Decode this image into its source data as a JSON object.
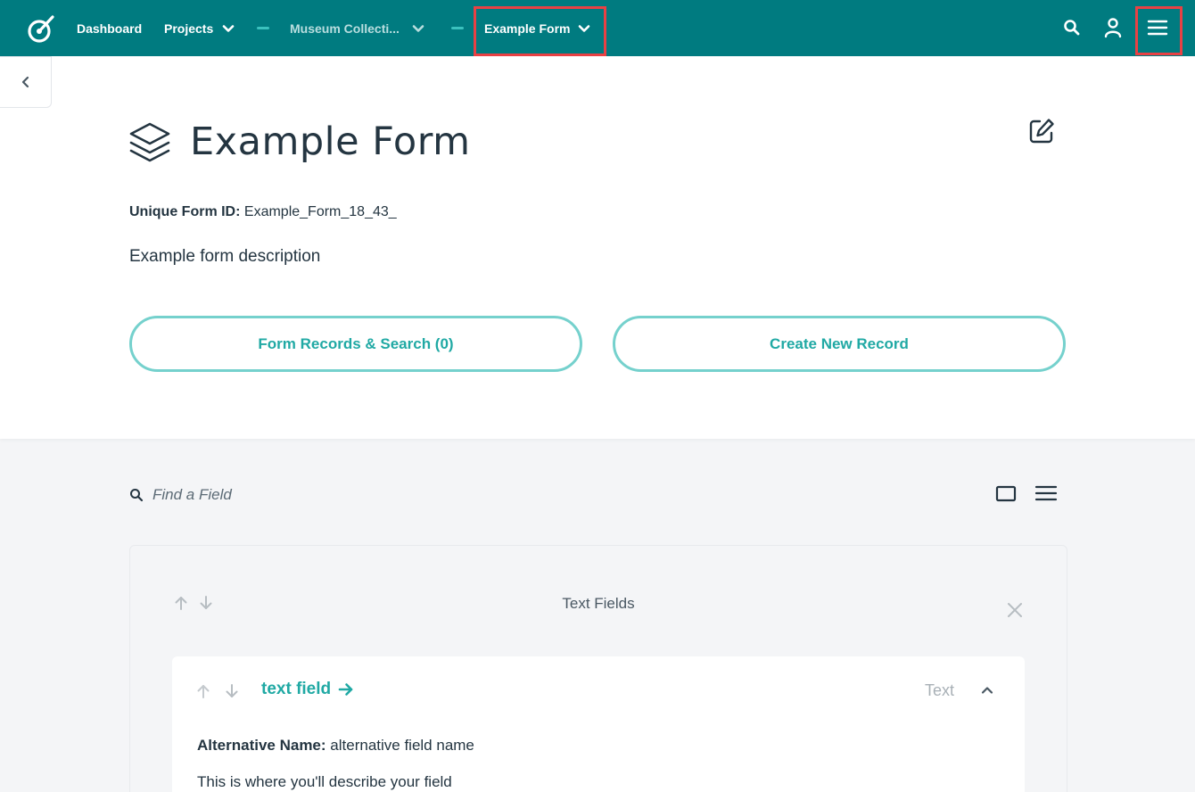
{
  "colors": {
    "topbar": "#007b80",
    "accent": "#20a9a4",
    "pill_border": "#75d1cd",
    "highlight": "#e84144"
  },
  "topbar": {
    "logo_icon": "logo-icon",
    "nav": {
      "dashboard": "Dashboard",
      "projects": "Projects",
      "project_name": "Museum Collecti...",
      "form_name": "Example Form"
    },
    "icons": [
      "search-icon",
      "user-icon",
      "menu-icon"
    ]
  },
  "header": {
    "title": "Example Form",
    "unique_id_label": "Unique Form ID:",
    "unique_id_value": "Example_Form_18_43_",
    "description": "Example form description",
    "records_button": "Form Records & Search (0)",
    "create_button": "Create New Record"
  },
  "fields_toolbar": {
    "search_placeholder": "Find a Field"
  },
  "page_section": {
    "title": "Text Fields",
    "field": {
      "name": "text field",
      "type": "Text",
      "alt_name_label": "Alternative Name:",
      "alt_name_value": "alternative field name",
      "description": "This is where you'll describe your field"
    }
  }
}
